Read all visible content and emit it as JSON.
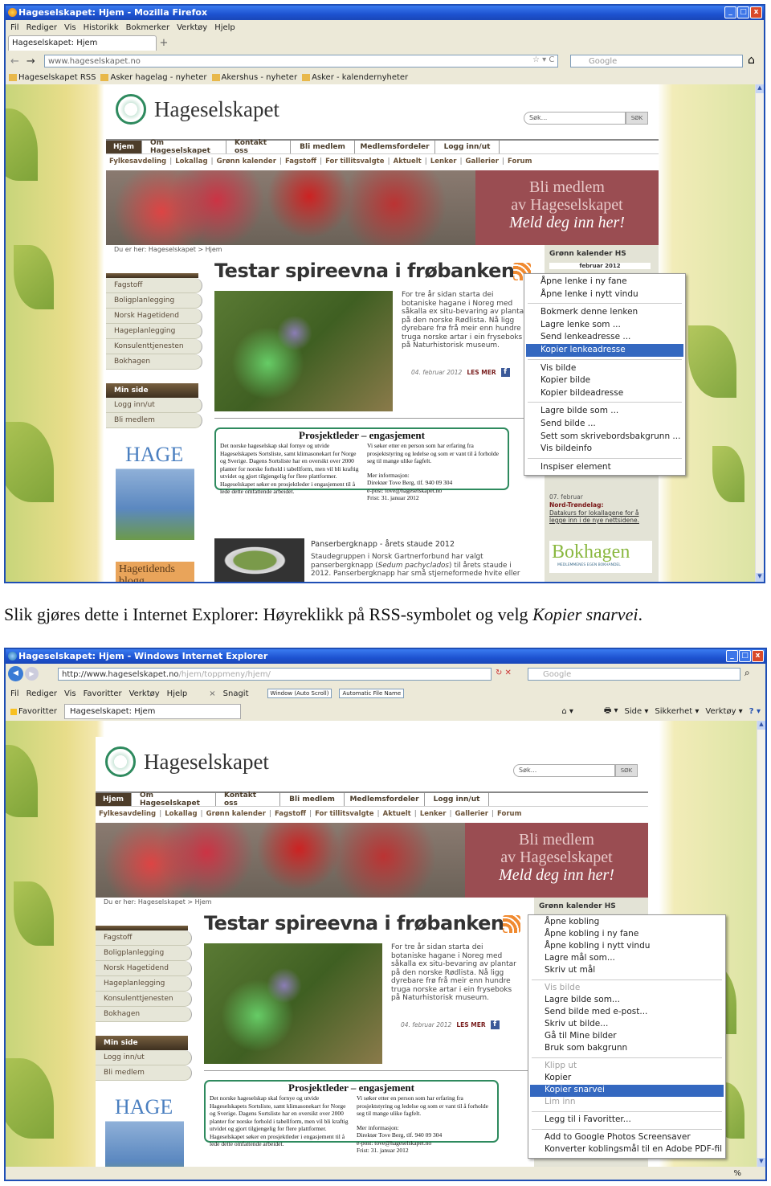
{
  "firefox": {
    "title": "Hageselskapet: Hjem - Mozilla Firefox",
    "menu": [
      "Fil",
      "Rediger",
      "Vis",
      "Historikk",
      "Bokmerker",
      "Verktøy",
      "Hjelp"
    ],
    "tab": "Hageselskapet: Hjem",
    "new_tab": "+",
    "url": "www.hageselskapet.no",
    "search_placeholder": "Google",
    "bookmarks": [
      "Hageselskapet RSS",
      "Asker hagelag - nyheter",
      "Akershus - nyheter",
      "Asker - kalendernyheter"
    ],
    "context_menu": [
      [
        {
          "label": "Åpne lenke i ny fane"
        },
        {
          "label": "Åpne lenke i nytt vindu"
        }
      ],
      [
        {
          "label": "Bokmerk denne lenken"
        },
        {
          "label": "Lagre lenke som ..."
        },
        {
          "label": "Send lenkeadresse ..."
        },
        {
          "label": "Kopier lenkeadresse",
          "highlighted": true
        }
      ],
      [
        {
          "label": "Vis bilde"
        },
        {
          "label": "Kopier bilde"
        },
        {
          "label": "Kopier bildeadresse"
        }
      ],
      [
        {
          "label": "Lagre bilde som ..."
        },
        {
          "label": "Send bilde ..."
        },
        {
          "label": "Sett som skrivebordsbakgrunn ..."
        },
        {
          "label": "Vis bildeinfo"
        }
      ],
      [
        {
          "label": "Inspiser element"
        }
      ]
    ]
  },
  "caption": {
    "text": "Slik gjøres dette i Internet Explorer: Høyreklikk på RSS-symbolet og velg ",
    "emphasis": "Kopier snarvei",
    "end": "."
  },
  "ie": {
    "title": "Hageselskapet: Hjem - Windows Internet Explorer",
    "url_host": "http://www.hageselskapet.no",
    "url_path": "/hjem/toppmeny/hjem/",
    "search_placeholder": "Google",
    "menu": [
      "Fil",
      "Rediger",
      "Vis",
      "Favoritter",
      "Verktøy",
      "Hjelp"
    ],
    "snagit": "Snagit",
    "snagit_mode": "Window (Auto Scroll)",
    "snagit_file": "Automatic File Name",
    "favorites": "Favoritter",
    "tab": "Hageselskapet: Hjem",
    "commands": [
      "Side ▾",
      "Sikkerhet ▾",
      "Verktøy ▾"
    ],
    "status_zoom": "%",
    "context_menu": [
      [
        {
          "label": "Åpne kobling"
        },
        {
          "label": "Åpne kobling i ny fane"
        },
        {
          "label": "Åpne kobling i nytt vindu"
        },
        {
          "label": "Lagre mål som..."
        },
        {
          "label": "Skriv ut mål"
        }
      ],
      [
        {
          "label": "Vis bilde",
          "disabled": true
        },
        {
          "label": "Lagre bilde som..."
        },
        {
          "label": "Send bilde med e-post..."
        },
        {
          "label": "Skriv ut bilde..."
        },
        {
          "label": "Gå til Mine bilder"
        },
        {
          "label": "Bruk som bakgrunn"
        }
      ],
      [
        {
          "label": "Klipp ut",
          "disabled": true
        },
        {
          "label": "Kopier"
        },
        {
          "label": "Kopier snarvei",
          "highlighted": true
        },
        {
          "label": "Lim inn",
          "disabled": true
        }
      ],
      [
        {
          "label": "Legg til i Favoritter..."
        }
      ],
      [
        {
          "label": "Add to Google Photos Screensaver"
        },
        {
          "label": "Konverter koblingsmål til en Adobe PDF-fil"
        }
      ]
    ]
  },
  "site": {
    "name": "Hageselskapet",
    "search_placeholder": "Søk...",
    "search_button": "SØK",
    "nav": [
      "Hjem",
      "Om Hageselskapet",
      "Kontakt oss",
      "Bli medlem",
      "Medlemsfordeler",
      "Logg inn/ut"
    ],
    "subnav": [
      "Fylkesavdeling",
      "Lokallag",
      "Grønn kalender",
      "Fagstoff",
      "For tillitsvalgte",
      "Aktuelt",
      "Lenker",
      "Gallerier",
      "Forum"
    ],
    "promo": [
      "Bli medlem",
      "av Hageselskapet",
      "Meld deg inn her!"
    ],
    "breadcrumb": "Du er her: Hageselskapet > Hjem",
    "sidebar": [
      "Fagstoff",
      "Boligplanlegging",
      "Norsk Hagetidend",
      "Hageplanlegging",
      "Konsulenttjenesten",
      "Bokhagen"
    ],
    "min_side": {
      "title": "Min side",
      "items": [
        "Logg inn/ut",
        "Bli medlem"
      ]
    },
    "magazine": "HAGE",
    "blog": "Hagetidends blogg",
    "article": {
      "title": "Testar spireevna i frøbanken",
      "body": "For tre år sidan starta dei botaniske hagane i Noreg med såkalla ex situ-bevaring av plantar på den norske Rødlista. Nå ligg dyrebare frø frå meir enn hundre truga norske artar i ein fryseboks på Naturhistorisk museum.",
      "date": "04. februar 2012",
      "more": "LES MER"
    },
    "job": {
      "title": "Prosjektleder – engasjement",
      "left": "Det norske hageselskap skal fornye og utvide Hageselskapets Sortsliste, samt klimasonekart for Norge og Sverige. Dagens Sortsliste har en oversikt over 2000 planter for norske forhold i tabellform, men vil bli kraftig utvidet og gjort tilgjengelig for flere plattformer. Hageselskapet søker en prosjektleder i engasjement til å lede dette omfattende arbeidet.",
      "right": "Vi søker etter en person som har erfaring fra prosjektstyring og ledelse og som er vant til å forholde seg til mange ulike fagfelt.",
      "info": [
        "Mer informasjon:",
        "Direktør Tove Berg, tlf. 940 09 304",
        "e-post: tove@hageselskapet.no",
        "Frist: 31. januar 2012"
      ]
    },
    "item2": {
      "title": "Panserbergknapp - årets staude 2012",
      "text_a": "Staudegruppen i Norsk Gartnerforbund har valgt panserbergknapp (",
      "text_i": "Sedum pachyclados",
      "text_b": ") til årets staude i 2012. Panserbergknapp har små stjerneformede hvite eller"
    },
    "calendar": {
      "title": "Grønn kalender HS",
      "month": "februar 2012",
      "event_date": "07. februar",
      "event_org": "Nord-Trøndelag:",
      "event_link": "Datakurs for lokallagene for å legge inn i de nye nettsidene."
    },
    "bokhagen": {
      "name": "Bokhagen",
      "tagline": "MEDLEMMENES EGEN BOKHANDEL"
    },
    "colors": {
      "brown": "#4d3d2a",
      "promo": "#9a4d52",
      "green": "#2e8a5e",
      "highlight": "#3468c0"
    }
  }
}
